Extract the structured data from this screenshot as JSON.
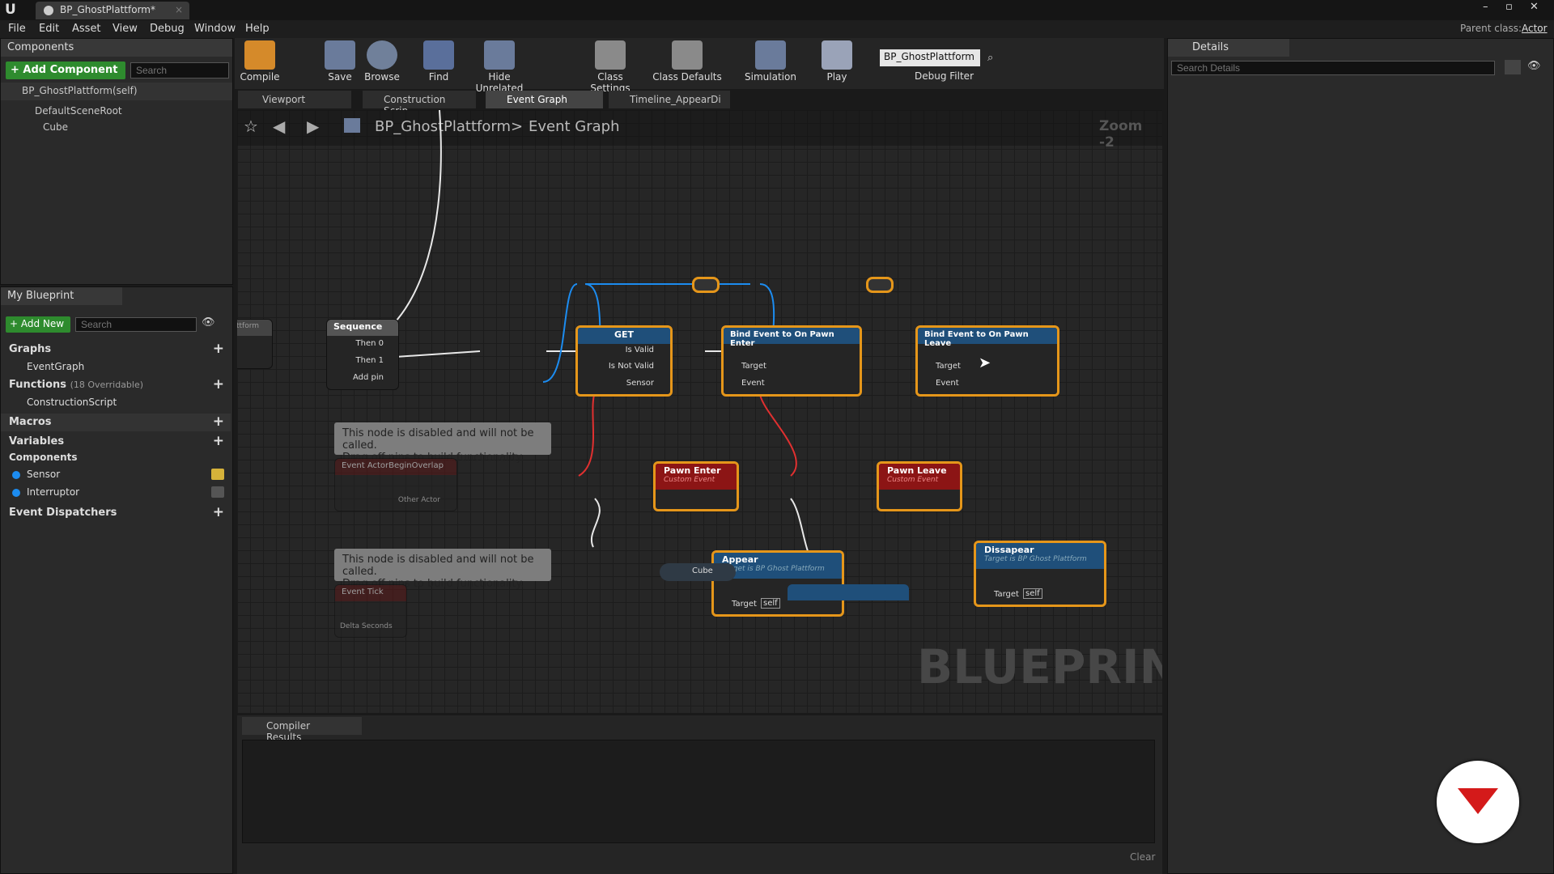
{
  "window": {
    "tab_title": "BP_GhostPlattform*",
    "parent_class_label": "Parent class:",
    "parent_class_value": "Actor"
  },
  "menu": [
    "File",
    "Edit",
    "Asset",
    "View",
    "Debug",
    "Window",
    "Help"
  ],
  "components_panel": {
    "title": "Components",
    "add_button": "+ Add Component",
    "search_placeholder": "Search",
    "root_item": "BP_GhostPlattform(self)",
    "tree": [
      "DefaultSceneRoot",
      "Cube"
    ]
  },
  "toolbar": {
    "compile": "Compile",
    "save": "Save",
    "browse": "Browse",
    "find": "Find",
    "hide_unrelated": "Hide Unrelated",
    "class_settings": "Class Settings",
    "class_defaults": "Class Defaults",
    "simulation": "Simulation",
    "play": "Play",
    "debug_object": "BP_GhostPlattform",
    "debug_filter": "Debug Filter"
  },
  "editor_tabs": [
    "Viewport",
    "Construction Scrip",
    "Event Graph",
    "Timeline_AppearDi"
  ],
  "breadcrumb": {
    "blueprint": "BP_GhostPlattform",
    "graph": "Event Graph",
    "zoom": "Zoom -2"
  },
  "my_blueprint": {
    "title": "My Blueprint",
    "add_new": "+ Add New",
    "search_placeholder": "Search",
    "graphs_label": "Graphs",
    "event_graph": "EventGraph",
    "functions_label": "Functions",
    "functions_count": "(18 Overridable)",
    "construction_script": "ConstructionScript",
    "macros_label": "Macros",
    "variables_label": "Variables",
    "components_label": "Components",
    "sensor": "Sensor",
    "interruptor": "Interruptor",
    "event_dispatchers": "Event Dispatchers"
  },
  "graph": {
    "left_node_partial": "ttform",
    "sequence": {
      "title": "Sequence",
      "then0": "Then 0",
      "then1": "Then 1",
      "add_pin": "Add pin"
    },
    "get": {
      "title": "GET",
      "is_valid": "Is Valid",
      "is_not_valid": "Is Not Valid",
      "sensor": "Sensor"
    },
    "bind_enter": {
      "title": "Bind Event to On Pawn Enter",
      "target": "Target",
      "event": "Event"
    },
    "bind_leave": {
      "title": "Bind Event to On Pawn Leave",
      "target": "Target",
      "event": "Event"
    },
    "comment1": {
      "line1": "This node is disabled and will not be called.",
      "line2": "Drag off pins to build functionality."
    },
    "comment2": {
      "line1": "This node is disabled and will not be called.",
      "line2": "Drag off pins to build functionality."
    },
    "begin_overlap": {
      "title": "Event ActorBeginOverlap",
      "other_actor": "Other Actor"
    },
    "event_tick": {
      "title": "Event Tick",
      "delta_seconds": "Delta Seconds"
    },
    "pawn_enter": {
      "title": "Pawn Enter",
      "subtitle": "Custom Event"
    },
    "pawn_leave": {
      "title": "Pawn Leave",
      "subtitle": "Custom Event"
    },
    "appear": {
      "title": "Appear",
      "subtitle": "Target is BP Ghost Plattform",
      "target": "Target",
      "self": "self"
    },
    "dissapear": {
      "title": "Dissapear",
      "subtitle": "Target is BP Ghost Plattform",
      "target": "Target",
      "self": "self"
    },
    "cube_node": "Cube",
    "watermark": "BLUEPRINT"
  },
  "compiler": {
    "title": "Compiler Results",
    "clear": "Clear"
  },
  "details": {
    "title": "Details",
    "search_placeholder": "Search Details"
  },
  "colors": {
    "accent_orange": "#e5961a",
    "event_red": "#8c1515",
    "function_blue": "#1f4f7a",
    "exec_white": "#ffffff",
    "object_blue": "#1c8cf0",
    "add_green": "#2e8b2e"
  }
}
